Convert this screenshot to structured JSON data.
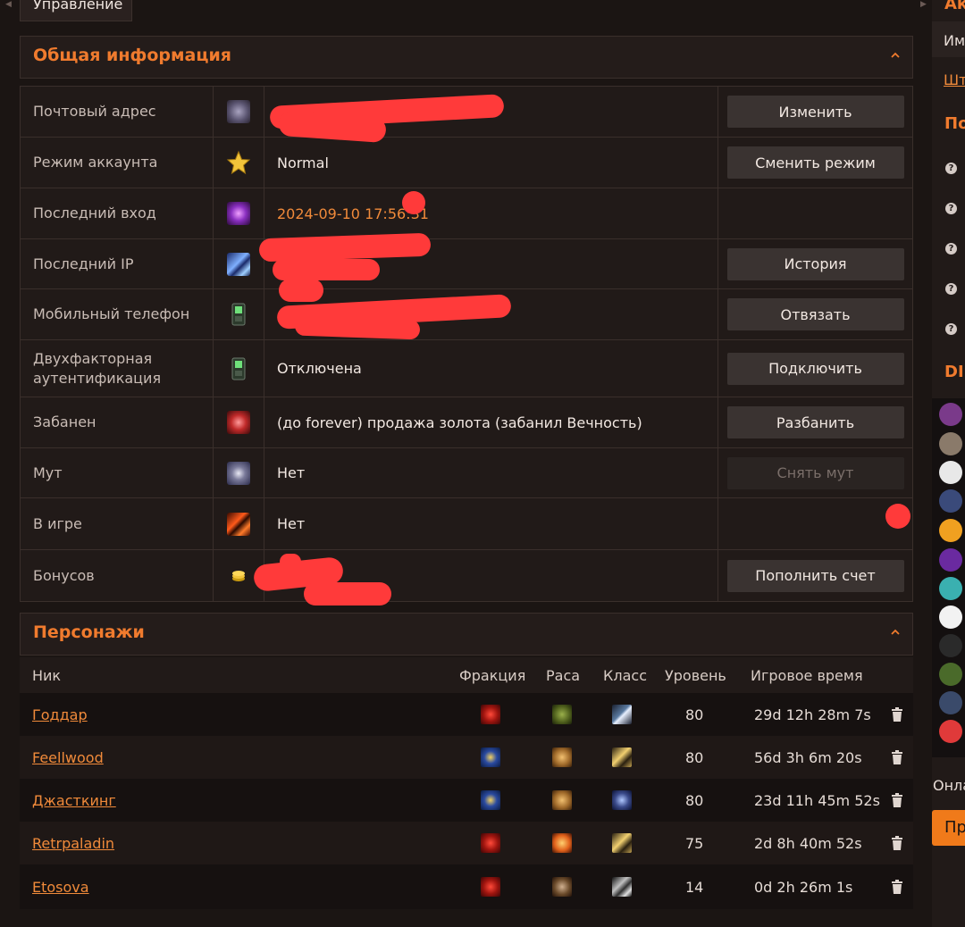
{
  "top_tab": "Управление",
  "general": {
    "title": "Общая информация",
    "rows": [
      {
        "label": "Почтовый адрес",
        "value": "",
        "button": "Изменить",
        "icon": "mail-icon"
      },
      {
        "label": "Режим аккаунта",
        "value": "Normal",
        "button": "Сменить режим",
        "icon": "star-icon"
      },
      {
        "label": "Последний вход",
        "value": "2024-09-10 17:56:31",
        "button": "",
        "icon": "portal-icon"
      },
      {
        "label": "Последний IP",
        "value": "",
        "button": "История",
        "icon": "network-icon"
      },
      {
        "label": "Мобильный телефон",
        "value": "",
        "button": "Отвязать",
        "icon": "phone-icon"
      },
      {
        "label": "Двухфакторная аутентификация",
        "value": "Отключена",
        "button": "Подключить",
        "icon": "phone-icon"
      },
      {
        "label": "Забанен",
        "value": "(до forever) продажа золота (забанил Вечность)",
        "button": "Разбанить",
        "icon": "ban-hand-icon"
      },
      {
        "label": "Мут",
        "value": "Нет",
        "button": "Снять мут",
        "icon": "mute-icon"
      },
      {
        "label": "В игре",
        "value": "Нет",
        "button": "",
        "icon": "fire-icon"
      },
      {
        "label": "Бонусов",
        "value": "",
        "button": "Пополнить счет",
        "icon": "coins-icon"
      }
    ]
  },
  "characters": {
    "title": "Персонажи",
    "columns": {
      "nick": "Ник",
      "faction": "Фракция",
      "race": "Раса",
      "class": "Класс",
      "level": "Уровень",
      "playtime": "Игровое время"
    },
    "rows": [
      {
        "nick": "Годдар",
        "faction": "horde",
        "race": "orc",
        "class": "warrior",
        "level": "80",
        "playtime": "29d 12h 28m 7s"
      },
      {
        "nick": "Feellwood",
        "faction": "alliance",
        "race": "human",
        "class": "paladin",
        "level": "80",
        "playtime": "56d 3h 6m 20s"
      },
      {
        "nick": "Джасткинг",
        "faction": "alliance",
        "race": "human",
        "class": "death-knight",
        "level": "80",
        "playtime": "23d 11h 45m 52s"
      },
      {
        "nick": "Retrpaladin",
        "faction": "horde",
        "race": "blood-elf",
        "class": "paladin",
        "level": "75",
        "playtime": "2d 8h 40m 52s"
      },
      {
        "nick": "Etosova",
        "faction": "horde",
        "race": "tauren",
        "class": "warrior",
        "level": "14",
        "playtime": "0d 2h 26m 1s"
      }
    ]
  },
  "sidebar": {
    "top_heading": "Ак",
    "name_label": "Им",
    "link": "Шт",
    "heading2": "По",
    "heading3": "DIS",
    "online_label": "Онла",
    "button_label": "Пр"
  },
  "colors": {
    "accent": "#f07b2e",
    "background": "#1b1513",
    "panel": "#211a18",
    "redaction": "#ff3a3a"
  }
}
